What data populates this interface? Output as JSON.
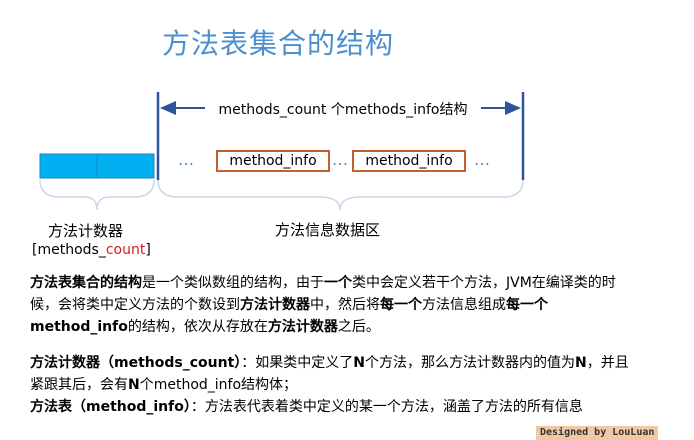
{
  "title": "方法表集合的结构",
  "span_label": "methods_count 个methods_info结构",
  "method_info_1": "method_info",
  "method_info_2": "method_info",
  "dots": "…",
  "counter_label": "方法计数器",
  "counter_sub_open": "[methods_",
  "counter_sub_red": "count",
  "counter_sub_close": "]",
  "region_label": "方法信息数据区",
  "para1": {
    "t1": "方法表集合的结构",
    "t2": "是一个类似数组的结构，由于",
    "t3": "一个",
    "t4": "类中会定义若干个方法，JVM",
    "t5": "在编译类的时候，会将类中定义方法的个数设到",
    "t6": "方法计数器",
    "t7": "中，然后将",
    "t8": "每一个",
    "t9": "方法信息组成",
    "t10": "每一个method_info",
    "t11": "的结构，依次从存放在",
    "t12": "方法计数器",
    "t13": "之后。"
  },
  "para2": {
    "b1": "方法计数器（methods_count）",
    "t1": "：如果类中定义了",
    "b2": "N",
    "t2": "个方法，那么方法计数器内的值为",
    "b3": "N",
    "t3": "，并且紧跟其后，会有",
    "b4": "N",
    "t4": "个method_info结构体；"
  },
  "para3": {
    "b1": "方法表（method_info）",
    "t1": "：方法表代表着类中定义的某一个方法，涵盖了方法的所有信息"
  },
  "stamp": "Designed by LouLuan",
  "colors": {
    "title": "#4a8fd0",
    "counter_fill": "#00b0f0",
    "method_border": "#c0622a",
    "arrow": "#2e5597",
    "brace": "#c9d7ea"
  }
}
